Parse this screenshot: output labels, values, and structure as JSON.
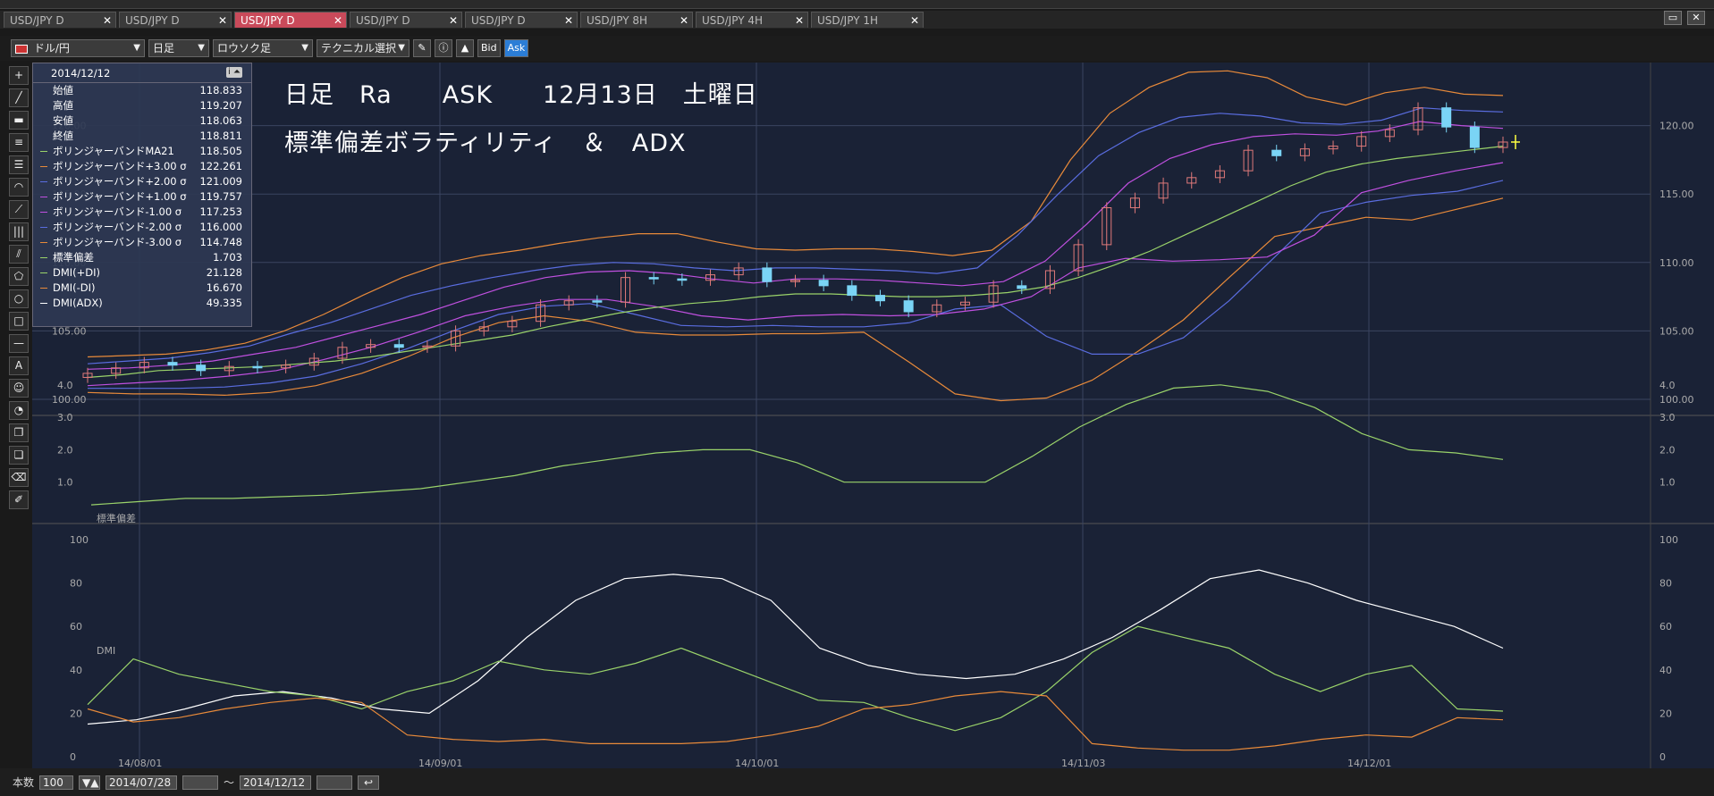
{
  "tabs": [
    {
      "label": "USD/JPY D",
      "active": false
    },
    {
      "label": "USD/JPY D",
      "active": false
    },
    {
      "label": "USD/JPY D",
      "active": true
    },
    {
      "label": "USD/JPY D",
      "active": false
    },
    {
      "label": "USD/JPY D",
      "active": false
    },
    {
      "label": "USD/JPY 8H",
      "active": false
    },
    {
      "label": "USD/JPY 4H",
      "active": false
    },
    {
      "label": "USD/JPY 1H",
      "active": false
    }
  ],
  "tab_close": "✕",
  "toolbar": {
    "pair": "ドル/円",
    "timeframe": "日足",
    "chart_type": "ロウソク足",
    "technical": "テクニカル選択",
    "bid": "Bid",
    "ask": "Ask"
  },
  "info": {
    "date": "2014/12/12",
    "rows": [
      {
        "label": "始値",
        "value": "118.833",
        "color": ""
      },
      {
        "label": "高値",
        "value": "119.207",
        "color": ""
      },
      {
        "label": "安値",
        "value": "118.063",
        "color": ""
      },
      {
        "label": "終値",
        "value": "118.811",
        "color": ""
      },
      {
        "label": "ボリンジャーバンドMA21",
        "value": "118.505",
        "color": "#9ad36a"
      },
      {
        "label": "ボリンジャーバンド+3.00 σ",
        "value": "122.261",
        "color": "#e88a3a"
      },
      {
        "label": "ボリンジャーバンド+2.00 σ",
        "value": "121.009",
        "color": "#5a6de0"
      },
      {
        "label": "ボリンジャーバンド+1.00 σ",
        "value": "119.757",
        "color": "#c050e0"
      },
      {
        "label": "ボリンジャーバンド-1.00 σ",
        "value": "117.253",
        "color": "#c050e0"
      },
      {
        "label": "ボリンジャーバンド-2.00 σ",
        "value": "116.000",
        "color": "#5a6de0"
      },
      {
        "label": "ボリンジャーバンド-3.00 σ",
        "value": "114.748",
        "color": "#e88a3a"
      },
      {
        "label": "標準偏差",
        "value": "1.703",
        "color": "#9ad36a"
      },
      {
        "label": "DMI(+DI)",
        "value": "21.128",
        "color": "#9ad36a"
      },
      {
        "label": "DMI(-DI)",
        "value": "16.670",
        "color": "#e88a3a"
      },
      {
        "label": "DMI(ADX)",
        "value": "49.335",
        "color": "#ffffff"
      }
    ]
  },
  "annotation": {
    "line1": "日足　Ra　　ASK　　12月13日　土曜日",
    "line2": "標準偏差ボラティリティ　＆　ADX"
  },
  "colors": {
    "ma": "#9ad36a",
    "sigma3": "#e88a3a",
    "sigma2": "#5a6de0",
    "sigma1": "#c050e0",
    "up_candle": "#e07a7a",
    "down_candle": "#7ad4f5",
    "adx": "#ffffff",
    "plus_di": "#9ad36a",
    "minus_di": "#e88a3a"
  },
  "chart_data": [
    {
      "type": "candlestick",
      "name": "USD/JPY Daily",
      "ylim": [
        100,
        125
      ],
      "yticks": [
        "125.00",
        "120.00",
        "115.00",
        "110.00",
        "105.00",
        "100.00"
      ],
      "xticks": [
        "14/08/01",
        "14/09/01",
        "14/10/01",
        "14/11/03",
        "14/12/01"
      ],
      "x": [
        "07/28",
        "07/30",
        "08/01",
        "08/05",
        "08/07",
        "08/11",
        "08/13",
        "08/15",
        "08/19",
        "08/21",
        "08/25",
        "08/27",
        "08/29",
        "09/02",
        "09/04",
        "09/08",
        "09/10",
        "09/12",
        "09/16",
        "09/18",
        "09/22",
        "09/24",
        "09/26",
        "09/30",
        "10/02",
        "10/06",
        "10/08",
        "10/10",
        "10/14",
        "10/16",
        "10/20",
        "10/22",
        "10/24",
        "10/28",
        "10/30",
        "11/03",
        "11/05",
        "11/07",
        "11/11",
        "11/13",
        "11/17",
        "11/19",
        "11/21",
        "11/25",
        "11/27",
        "12/01",
        "12/03",
        "12/05",
        "12/09",
        "12/11",
        "12/12"
      ],
      "close": [
        101.9,
        102.3,
        102.7,
        102.5,
        102.1,
        102.4,
        102.3,
        102.5,
        103.0,
        103.8,
        104.0,
        103.8,
        103.9,
        105.0,
        105.3,
        105.7,
        106.9,
        107.2,
        107.1,
        108.9,
        108.8,
        108.7,
        109.1,
        109.6,
        108.6,
        108.7,
        108.3,
        107.6,
        107.2,
        106.4,
        106.9,
        107.1,
        108.3,
        108.1,
        109.4,
        111.3,
        114.0,
        114.7,
        115.8,
        116.2,
        116.7,
        118.2,
        117.8,
        118.3,
        118.5,
        119.2,
        119.7,
        121.3,
        119.9,
        118.4,
        118.8
      ],
      "bb_ma21": [
        101.6,
        101.8,
        102.1,
        102.2,
        102.3,
        102.4,
        102.6,
        102.8,
        103.1,
        103.5,
        103.9,
        104.3,
        104.7,
        105.3,
        105.8,
        106.3,
        106.7,
        107.0,
        107.2,
        107.5,
        107.7,
        107.7,
        107.6,
        107.5,
        107.5,
        107.6,
        107.8,
        108.2,
        108.9,
        109.8,
        110.8,
        112.0,
        113.2,
        114.4,
        115.6,
        116.6,
        117.2,
        117.6,
        117.9,
        118.2,
        118.5
      ],
      "bb_plus3": [
        103.1,
        103.2,
        103.3,
        103.6,
        104.1,
        105.0,
        106.2,
        107.6,
        108.9,
        109.9,
        110.5,
        110.9,
        111.4,
        111.8,
        112.1,
        112.1,
        111.5,
        111.0,
        110.9,
        111.0,
        111.0,
        110.8,
        110.5,
        110.9,
        113.0,
        117.5,
        120.9,
        122.8,
        123.9,
        124.0,
        123.5,
        122.1,
        121.5,
        122.4,
        122.8,
        122.3,
        122.2
      ],
      "bb_plus2": [
        102.6,
        102.8,
        103.0,
        103.4,
        103.9,
        104.8,
        105.6,
        106.6,
        107.6,
        108.3,
        108.9,
        109.4,
        109.8,
        110.0,
        109.9,
        109.6,
        109.4,
        109.6,
        109.6,
        109.5,
        109.4,
        109.2,
        109.6,
        112.0,
        115.0,
        117.8,
        119.5,
        120.6,
        120.9,
        120.7,
        120.2,
        120.1,
        120.4,
        121.3,
        121.1,
        121.0
      ],
      "bb_plus1": [
        102.2,
        102.3,
        102.5,
        102.8,
        103.3,
        103.8,
        104.6,
        105.4,
        106.2,
        107.2,
        108.2,
        108.9,
        109.3,
        109.4,
        109.2,
        108.8,
        108.5,
        108.8,
        108.8,
        108.7,
        108.5,
        108.3,
        108.6,
        110.1,
        112.8,
        115.8,
        117.6,
        118.6,
        119.2,
        119.4,
        119.3,
        119.6,
        120.3,
        120.0,
        119.8
      ],
      "bb_minus1": [
        101.0,
        101.2,
        101.4,
        101.7,
        102.1,
        102.9,
        103.8,
        104.9,
        106.1,
        106.8,
        107.3,
        107.3,
        106.8,
        106.1,
        105.8,
        106.1,
        106.2,
        106.1,
        106.2,
        106.6,
        107.5,
        109.6,
        110.3,
        110.1,
        110.2,
        110.4,
        112.0,
        115.1,
        116.0,
        116.7,
        117.3
      ],
      "bb_minus2": [
        100.8,
        100.8,
        100.8,
        100.9,
        101.2,
        101.7,
        102.6,
        103.7,
        105.0,
        106.2,
        106.8,
        107.0,
        106.2,
        105.4,
        105.3,
        105.4,
        105.3,
        105.3,
        105.6,
        106.6,
        106.9,
        104.6,
        103.3,
        103.3,
        104.5,
        107.2,
        110.4,
        113.6,
        114.4,
        114.9,
        115.2,
        116.0
      ],
      "bb_minus3": [
        100.5,
        100.4,
        100.4,
        100.3,
        100.5,
        101.0,
        101.9,
        103.1,
        104.5,
        105.6,
        106.1,
        105.7,
        104.9,
        104.7,
        104.7,
        104.8,
        104.8,
        104.9,
        102.7,
        100.4,
        99.9,
        100.1,
        101.4,
        103.5,
        105.8,
        108.9,
        111.9,
        112.6,
        113.3,
        113.1,
        113.9,
        114.7
      ]
    },
    {
      "type": "line",
      "name": "標準偏差",
      "ylim": [
        0,
        4
      ],
      "yticks": [
        "4.0",
        "3.0",
        "2.0",
        "1.0"
      ],
      "values": [
        0.3,
        0.4,
        0.5,
        0.5,
        0.55,
        0.6,
        0.7,
        0.8,
        1.0,
        1.2,
        1.5,
        1.7,
        1.9,
        2.0,
        2.0,
        1.6,
        1.0,
        1.0,
        1.0,
        1.0,
        1.8,
        2.7,
        3.4,
        3.9,
        4.0,
        3.8,
        3.3,
        2.5,
        2.0,
        1.9,
        1.7
      ]
    },
    {
      "type": "line",
      "name": "DMI",
      "ylim": [
        0,
        100
      ],
      "yticks": [
        "100",
        "80",
        "60",
        "40",
        "20",
        "0"
      ],
      "series": [
        {
          "name": "DMI(ADX)",
          "values": [
            15,
            17,
            22,
            28,
            30,
            27,
            22,
            20,
            35,
            55,
            72,
            82,
            84,
            82,
            72,
            50,
            42,
            38,
            36,
            38,
            45,
            55,
            68,
            82,
            86,
            80,
            72,
            66,
            60,
            50
          ]
        },
        {
          "name": "DMI(+DI)",
          "values": [
            24,
            45,
            38,
            34,
            30,
            28,
            22,
            30,
            35,
            44,
            40,
            38,
            43,
            50,
            42,
            34,
            26,
            25,
            18,
            12,
            18,
            30,
            48,
            60,
            55,
            50,
            38,
            30,
            38,
            42,
            22,
            21
          ]
        },
        {
          "name": "DMI(-DI)",
          "values": [
            22,
            16,
            18,
            22,
            25,
            27,
            25,
            10,
            8,
            7,
            8,
            6,
            6,
            6,
            7,
            10,
            14,
            22,
            24,
            28,
            30,
            28,
            6,
            4,
            3,
            3,
            5,
            8,
            10,
            9,
            18,
            17
          ]
        }
      ]
    }
  ],
  "bottom": {
    "count_label": "本数",
    "count_value": "100",
    "date_from": "2014/07/28",
    "tilde": "〜",
    "date_to": "2014/12/12"
  }
}
